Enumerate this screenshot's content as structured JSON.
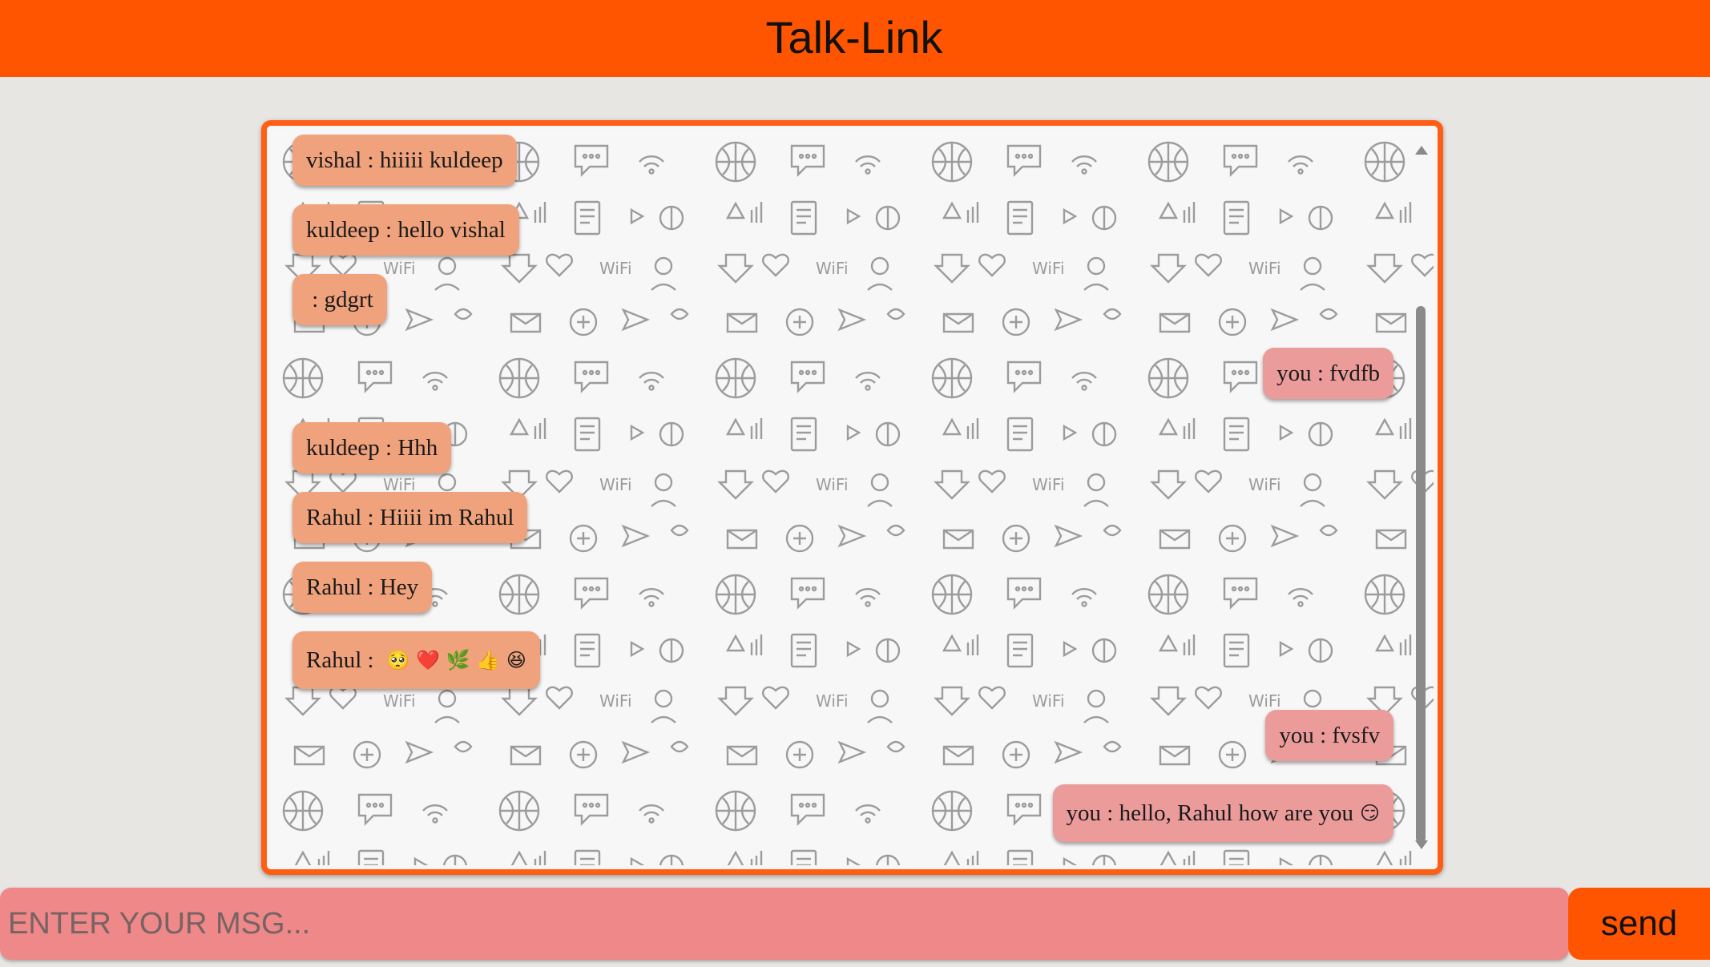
{
  "header": {
    "title": "Talk-Link"
  },
  "colors": {
    "accent": "#ff5500",
    "incoming_bubble": "#f0a27c",
    "outgoing_bubble": "#ec9b9b",
    "input_bg": "#ef8888"
  },
  "messages": [
    {
      "direction": "incoming",
      "sender": "vishal",
      "text": "vishal : hiiiii kuldeep"
    },
    {
      "direction": "incoming",
      "sender": "kuldeep",
      "text": "kuldeep : hello vishal"
    },
    {
      "direction": "incoming",
      "sender": "",
      "text": " : gdgrt"
    },
    {
      "direction": "outgoing",
      "sender": "you",
      "text": "you : fvdfb"
    },
    {
      "direction": "incoming",
      "sender": "kuldeep",
      "text": "kuldeep : Hhh"
    },
    {
      "direction": "incoming",
      "sender": "Rahul",
      "text": "Rahul : Hiiii im Rahul"
    },
    {
      "direction": "incoming",
      "sender": "Rahul",
      "text": "Rahul : Hey"
    },
    {
      "direction": "incoming",
      "sender": "Rahul",
      "text": "Rahul : ",
      "emoji": "🥺 ❤️ 🌿 👍 😆"
    },
    {
      "direction": "outgoing",
      "sender": "you",
      "text": "you : fvsfv"
    },
    {
      "direction": "outgoing",
      "sender": "you",
      "text": "you : hello, Rahul how are you",
      "emoji": "😏"
    }
  ],
  "composer": {
    "placeholder": "ENTER YOUR MSG...",
    "value": "",
    "send_label": "send"
  }
}
